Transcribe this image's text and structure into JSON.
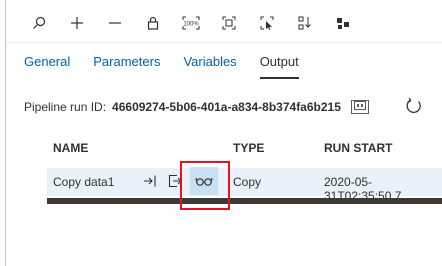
{
  "toolbar": {
    "icons": [
      "search-icon",
      "zoom-in-icon",
      "zoom-out-icon",
      "lock-icon",
      "zoom-100-icon",
      "fit-to-screen-icon",
      "select-icon",
      "auto-align-icon",
      "layout-icon"
    ],
    "zoom_100_label": "100%"
  },
  "tabs": [
    "General",
    "Parameters",
    "Variables",
    "Output"
  ],
  "active_tab": "Output",
  "pipeline_run": {
    "label": "Pipeline run ID:",
    "id": "46609274-5b06-401a-a834-8b374fa6b215"
  },
  "table": {
    "headers": [
      "NAME",
      "TYPE",
      "RUN START"
    ],
    "rows": [
      {
        "name": "Copy data1",
        "type": "Copy",
        "run_start": "2020-05-31T02:35:50.7"
      }
    ]
  },
  "colors": {
    "link": "#0062ad",
    "row_bg": "#e9f2fb",
    "highlight": "#c7e0f4",
    "annotation": "#e81123"
  }
}
